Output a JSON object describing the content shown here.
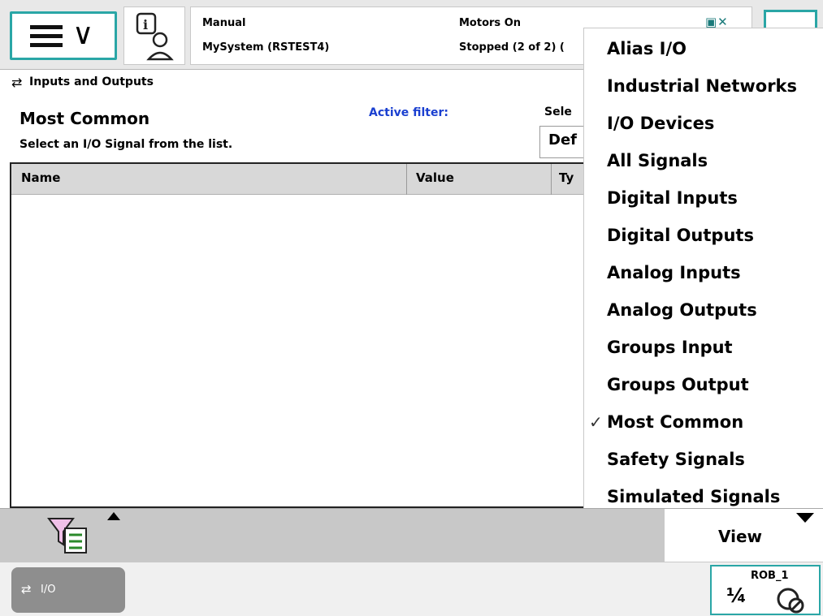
{
  "status": {
    "mode": "Manual",
    "system": "MySystem (RSTEST4)",
    "motors": "Motors On",
    "state": "Stopped (2 of 2) ("
  },
  "app": {
    "title": "Inputs and Outputs"
  },
  "header": {
    "heading": "Most Common",
    "subheading": "Select an I/O Signal from the list.",
    "active_filter": "Active filter:",
    "select_label": "Sele",
    "select_value": "Def"
  },
  "table": {
    "columns": [
      "Name",
      "Value",
      "Ty"
    ],
    "rows": []
  },
  "toolbar": {
    "view_label": "View"
  },
  "view_menu": {
    "items": [
      {
        "label": "Alias I/O",
        "checked": false
      },
      {
        "label": "Industrial Networks",
        "checked": false
      },
      {
        "label": "I/O Devices",
        "checked": false
      },
      {
        "label": "All Signals",
        "checked": false
      },
      {
        "label": "Digital Inputs",
        "checked": false
      },
      {
        "label": "Digital Outputs",
        "checked": false
      },
      {
        "label": "Analog Inputs",
        "checked": false
      },
      {
        "label": "Analog Outputs",
        "checked": false
      },
      {
        "label": "Groups Input",
        "checked": false
      },
      {
        "label": "Groups Output",
        "checked": false
      },
      {
        "label": "Most Common",
        "checked": true
      },
      {
        "label": "Safety Signals",
        "checked": false
      },
      {
        "label": "Simulated Signals",
        "checked": false
      }
    ],
    "check_glyph": "✓"
  },
  "taskbar": {
    "io_label": "I/O",
    "rob_label": "ROB_1",
    "rob_fraction": "¼"
  },
  "icons": {
    "menu": "hamburger-chevron-icon",
    "event_log": "info-person-icon",
    "io": "swap-arrows-icon",
    "filter": "funnel-document-icon",
    "robot_state": "motor-disabled-icon"
  },
  "colors": {
    "accent": "#2aa6a6",
    "filter_text": "#1a3fd0",
    "task_button": "#8e8e8e",
    "toolbar": "#c8c8c8"
  }
}
